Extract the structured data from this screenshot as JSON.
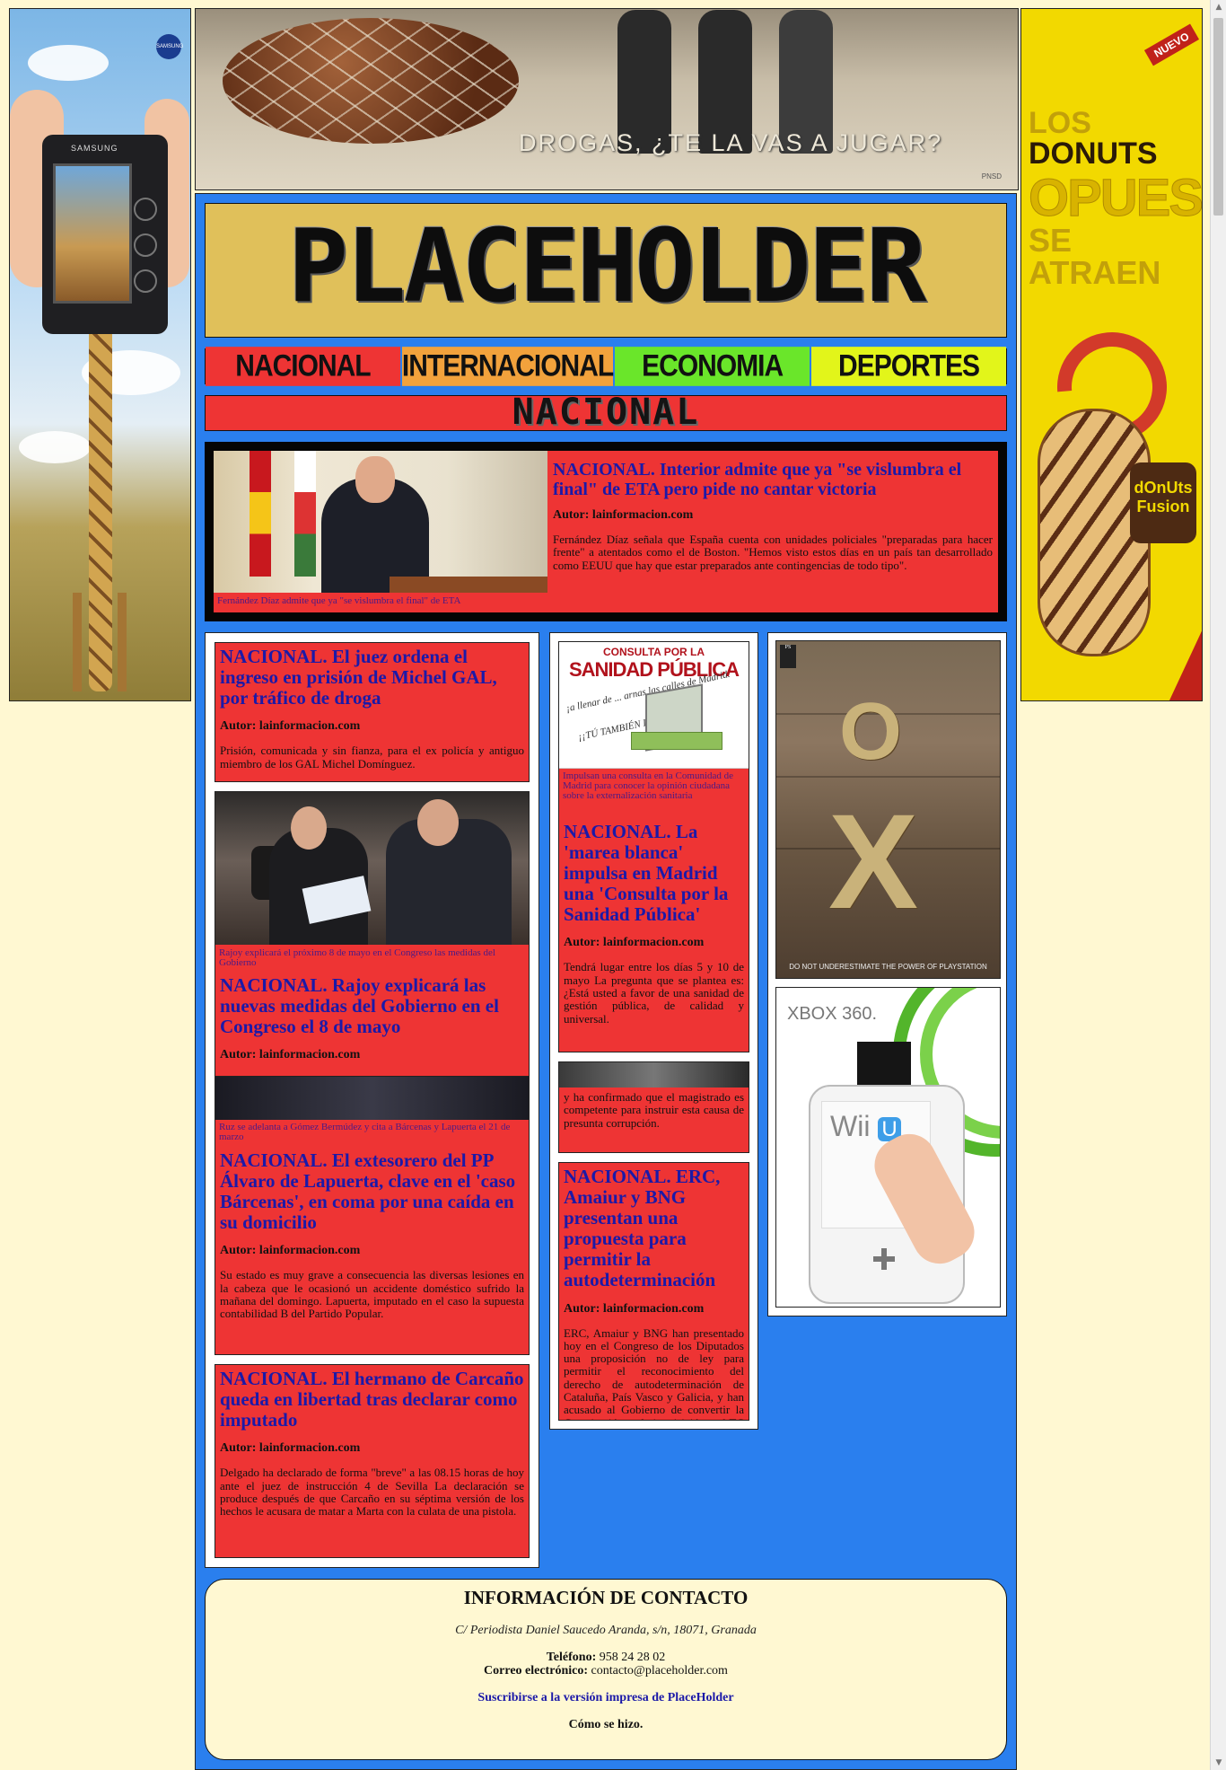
{
  "ads": {
    "left": {
      "brand": "SAMSUNG",
      "camera_brand": "SAMSUNG"
    },
    "right": {
      "badge": "NUEVO",
      "line1_light": "LOS",
      "line1_bold": "DONUTS",
      "line2": "OPUESTOS",
      "line3": "SE ATRAEN",
      "logo": "dOnUts Fusion"
    },
    "top_banner": {
      "caption": "DROGAS, ¿TE LA VAS A JUGAR?",
      "logo": "PNSD"
    },
    "playstation": {
      "letters": [
        "O",
        "X"
      ],
      "footer": "DO NOT UNDERESTIMATE  THE POWER OF PLAYSTATION",
      "logo": "PS"
    },
    "xbox_wii": {
      "xbox_title": "XBOX 360.",
      "wii_label": "Wii",
      "wii_u": "U"
    }
  },
  "site": {
    "logo": "PLACEHOLDER"
  },
  "nav": [
    {
      "label": "NACIONAL",
      "color": "#ee3434"
    },
    {
      "label": "INTERNACIONAL",
      "color": "#f2a23c"
    },
    {
      "label": "ECONOMIA",
      "color": "#6ae62a"
    },
    {
      "label": "DEPORTES",
      "color": "#e2f51a"
    }
  ],
  "section_title": "NACIONAL",
  "featured": {
    "headline": "NACIONAL. Interior admite que ya \"se vislumbra el final\" de ETA pero pide no cantar victoria",
    "author": "Autor: lainformacion.com",
    "body": "Fernández Díaz señala que España cuenta con unidades policiales \"preparadas para hacer frente\" a atentados como el de Boston. \"Hemos visto estos días en un país tan desarrollado como EEUU que hay que estar preparados ante contingencias de todo tipo\".",
    "caption": "Fernández Díaz admite que ya \"se vislumbra el final\" de ETA"
  },
  "col1": {
    "a1": {
      "headline": "NACIONAL. El juez ordena el ingreso en prisión de Michel GAL, por tráfico de droga",
      "author": "Autor: lainformacion.com",
      "body": "Prisión, comunicada y sin fianza, para el ex policía y antiguo miembro de los GAL Michel Domínguez."
    },
    "a2": {
      "caption": "Rajoy explicará el próximo 8 de mayo en el Congreso las medidas del Gobierno",
      "headline": "NACIONAL. Rajoy explicará las nuevas medidas del Gobierno en el Congreso el 8 de mayo",
      "author": "Autor: lainformacion.com"
    },
    "a3": {
      "caption": "Ruz se adelanta a Gómez Bermúdez y cita a Bárcenas y Lapuerta el 21 de marzo",
      "headline": "NACIONAL. El extesorero del PP Álvaro de Lapuerta, clave en el 'caso Bárcenas', en coma por una caída en su domicilio",
      "author": "Autor: lainformacion.com",
      "body": "Su estado es muy grave a consecuencia las diversas lesiones en la cabeza que le ocasionó un accidente doméstico sufrido la mañana del domingo. Lapuerta, imputado en el caso la supuesta contabilidad B del Partido Popular."
    },
    "a4": {
      "headline": "NACIONAL. El hermano de Carcaño queda en libertad tras declarar como imputado",
      "author": "Autor: lainformacion.com",
      "body": "Delgado ha declarado de forma \"breve\" a las 08.15 horas de hoy ante el juez de instrucción 4 de Sevilla La declaración se produce después de que Carcaño en su séptima versión de los hechos le acusara de matar a Marta con la culata de una pistola."
    }
  },
  "col2": {
    "a1": {
      "img_title_small": "CONSULTA POR LA",
      "img_title_big": "SANIDAD PÚBLICA",
      "img_note1": "¡a llenar de ... arnas las calles de Madrid.",
      "img_note2": "¡¡TÚ TAMBIÉN DECIDES!!",
      "caption": "Impulsan una consulta en la Comunidad de Madrid para conocer la opinión ciudadana sobre la externalización sanitaria",
      "headline": "NACIONAL. La 'marea blanca' impulsa en Madrid una 'Consulta por la Sanidad Pública'",
      "author": "Autor: lainformacion.com",
      "body": "Tendrá lugar entre los días 5 y 10 de mayo La pregunta que se plantea es: ¿Está usted a favor de una sanidad de gestión pública, de calidad y universal."
    },
    "a2": {
      "body": "y ha confirmado que el magistrado es competente para instruir esta causa de presunta corrupción."
    },
    "a3": {
      "headline": "NACIONAL. ERC, Amaiur y BNG presentan una propuesta para permitir la autodeterminación",
      "author": "Autor: lainformacion.com",
      "body": "ERC, Amaiur y BNG han presentado hoy en el Congreso de los Diputados una proposición no de ley para permitir el reconocimiento del derecho de autodeterminación de Cataluña, País Vasco y Galicia, y han acusado al Gobierno de convertir la Constitución en la inquisición y el TC en un tribunal inquisitorial."
    }
  },
  "contact": {
    "title": "INFORMACIÓN DE CONTACTO",
    "address": "C/ Periodista Daniel Saucedo Aranda, s/n, 18071, Granada",
    "phone_label": "Teléfono:",
    "phone": "958 24 28 02",
    "email_label": "Correo electrónico:",
    "email": "contacto@placeholder.com",
    "subscribe": "Suscribirse a la versión impresa de PlaceHolder",
    "how": "Cómo se hizo."
  }
}
